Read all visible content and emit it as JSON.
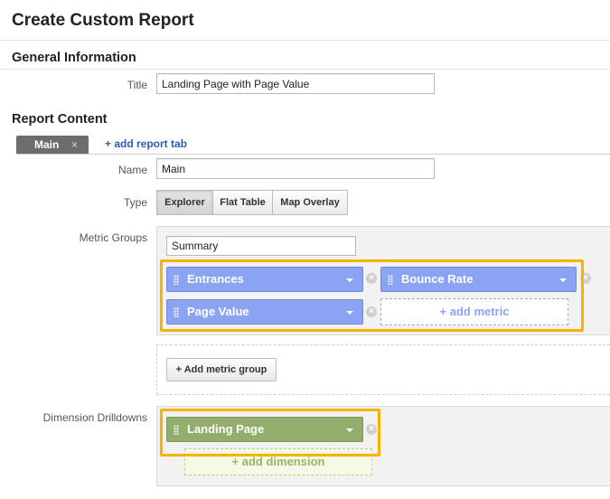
{
  "page": {
    "title": "Create Custom Report"
  },
  "general": {
    "section_title": "General Information",
    "title_label": "Title",
    "title_value": "Landing Page with Page Value"
  },
  "content": {
    "section_title": "Report Content",
    "tabs": [
      {
        "label": "Main",
        "close": "×"
      }
    ],
    "add_tab_label": "+ add report tab",
    "name_label": "Name",
    "name_value": "Main",
    "type_label": "Type",
    "type_options": [
      "Explorer",
      "Flat Table",
      "Map Overlay"
    ],
    "type_selected": "Explorer",
    "metric_groups_label": "Metric Groups",
    "metric_group_name": "Summary",
    "metrics": [
      "Entrances",
      "Bounce Rate",
      "Page Value"
    ],
    "add_metric_label": "+ add metric",
    "add_metric_group_label": "+ Add metric group",
    "dimension_label": "Dimension Drilldowns",
    "dimensions": [
      "Landing Page"
    ],
    "add_dimension_label": "+ add dimension"
  },
  "colors": {
    "metric_chip": "#8aa3f3",
    "dimension_chip": "#93ad6c",
    "highlight": "#f4b400"
  },
  "icons": {
    "drag": "drag-handle-icon",
    "dropdown": "chevron-down-icon",
    "remove": "close-circle-icon"
  }
}
